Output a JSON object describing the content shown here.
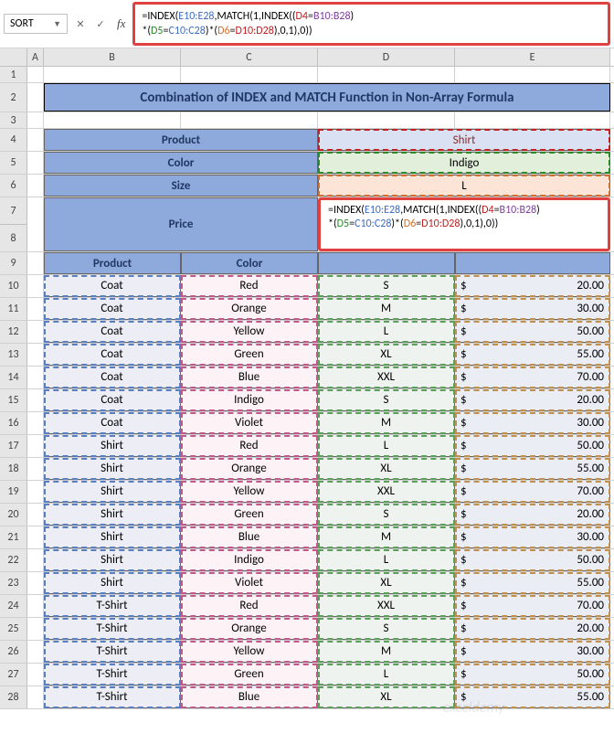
{
  "name_box": "SORT",
  "formula": {
    "line1_prefix": "=INDEX(",
    "e_range": "E10:E28",
    "mid1": ",MATCH(1,INDEX((",
    "d4": "D4",
    "eq1": "=",
    "b_range": "B10:B28",
    "close1": ")",
    "line2_prefix": "*(",
    "d5": "D5",
    "eq2": "=",
    "c_range": "C10:C28",
    "mid2": ")*(",
    "d6": "D6",
    "eq3": "=",
    "d_range": "D10:D28",
    "tail": "),0,1),0))"
  },
  "cols": {
    "A": "A",
    "B": "B",
    "C": "C",
    "D": "D",
    "E": "E"
  },
  "title": "Combination of INDEX and MATCH Function in Non-Array Formula",
  "labels": {
    "product": "Product",
    "color": "Color",
    "size": "Size",
    "price": "Price"
  },
  "lookup": {
    "product": "Shirt",
    "color": "Indigo",
    "size": "L"
  },
  "headers": {
    "product": "Product",
    "color": "Color"
  },
  "rows": [
    {
      "n": "10",
      "p": "Coat",
      "c": "Red",
      "s": "S",
      "cur": "$",
      "v": "20.00"
    },
    {
      "n": "11",
      "p": "Coat",
      "c": "Orange",
      "s": "M",
      "cur": "$",
      "v": "30.00"
    },
    {
      "n": "12",
      "p": "Coat",
      "c": "Yellow",
      "s": "L",
      "cur": "$",
      "v": "50.00"
    },
    {
      "n": "13",
      "p": "Coat",
      "c": "Green",
      "s": "XL",
      "cur": "$",
      "v": "55.00"
    },
    {
      "n": "14",
      "p": "Coat",
      "c": "Blue",
      "s": "XXL",
      "cur": "$",
      "v": "70.00"
    },
    {
      "n": "15",
      "p": "Coat",
      "c": "Indigo",
      "s": "S",
      "cur": "$",
      "v": "20.00"
    },
    {
      "n": "16",
      "p": "Coat",
      "c": "Violet",
      "s": "M",
      "cur": "$",
      "v": "30.00"
    },
    {
      "n": "17",
      "p": "Shirt",
      "c": "Red",
      "s": "L",
      "cur": "$",
      "v": "50.00"
    },
    {
      "n": "18",
      "p": "Shirt",
      "c": "Orange",
      "s": "XL",
      "cur": "$",
      "v": "55.00"
    },
    {
      "n": "19",
      "p": "Shirt",
      "c": "Yellow",
      "s": "XXL",
      "cur": "$",
      "v": "70.00"
    },
    {
      "n": "20",
      "p": "Shirt",
      "c": "Green",
      "s": "S",
      "cur": "$",
      "v": "20.00"
    },
    {
      "n": "21",
      "p": "Shirt",
      "c": "Blue",
      "s": "M",
      "cur": "$",
      "v": "30.00"
    },
    {
      "n": "22",
      "p": "Shirt",
      "c": "Indigo",
      "s": "L",
      "cur": "$",
      "v": "50.00"
    },
    {
      "n": "23",
      "p": "Shirt",
      "c": "Violet",
      "s": "XL",
      "cur": "$",
      "v": "55.00"
    },
    {
      "n": "24",
      "p": "T-Shirt",
      "c": "Red",
      "s": "XXL",
      "cur": "$",
      "v": "70.00"
    },
    {
      "n": "25",
      "p": "T-Shirt",
      "c": "Orange",
      "s": "S",
      "cur": "$",
      "v": "20.00"
    },
    {
      "n": "26",
      "p": "T-Shirt",
      "c": "Yellow",
      "s": "M",
      "cur": "$",
      "v": "30.00"
    },
    {
      "n": "27",
      "p": "T-Shirt",
      "c": "Green",
      "s": "L",
      "cur": "$",
      "v": "50.00"
    },
    {
      "n": "28",
      "p": "T-Shirt",
      "c": "Blue",
      "s": "XL",
      "cur": "$",
      "v": "55.00"
    }
  ],
  "watermark": "exceldemy"
}
